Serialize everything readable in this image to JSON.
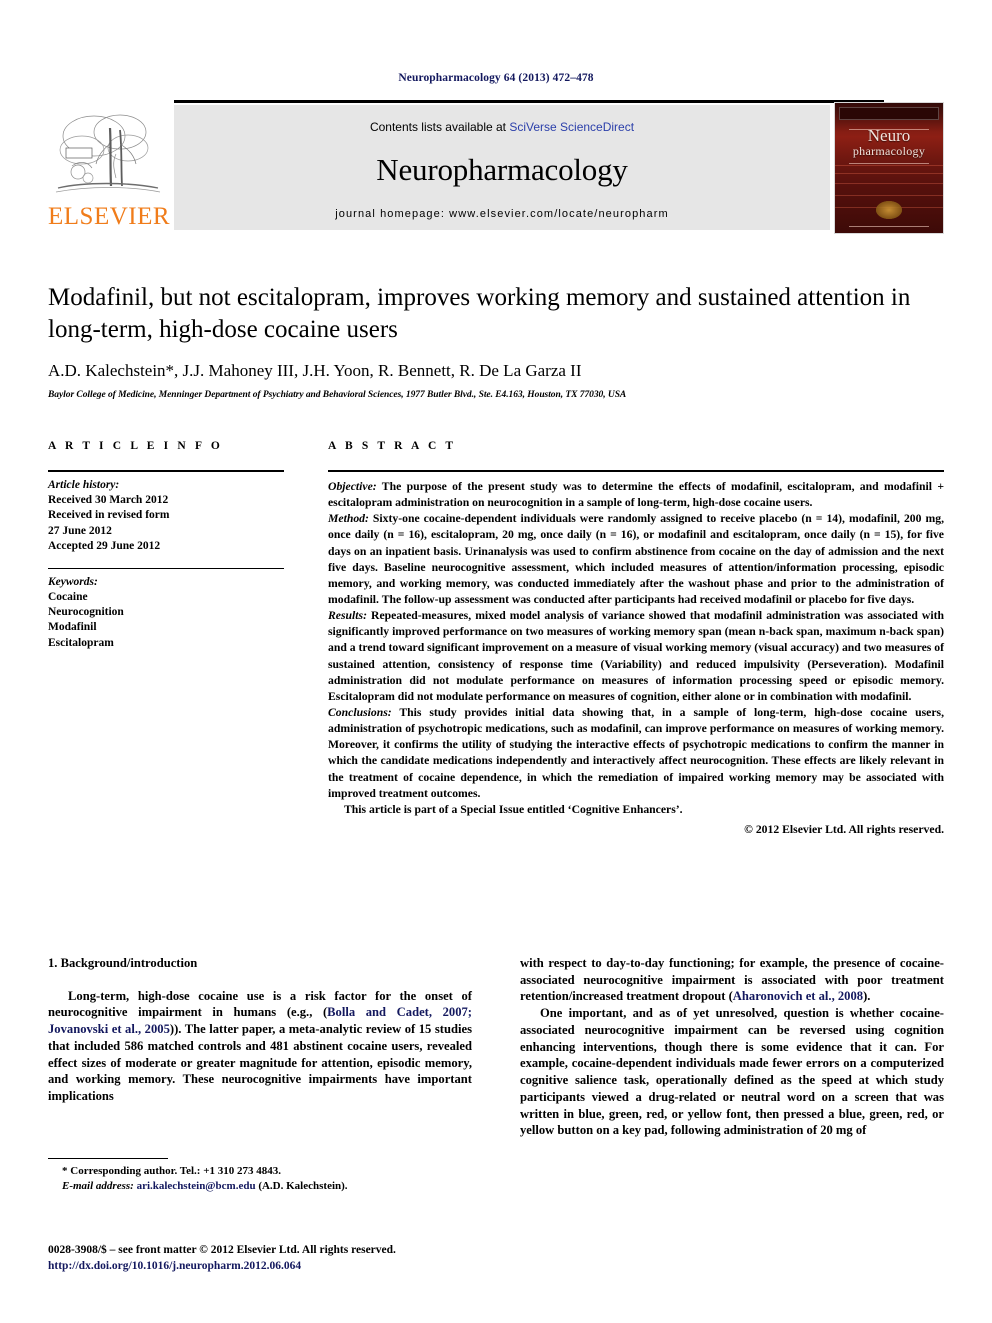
{
  "running_head": "Neuropharmacology 64 (2013) 472–478",
  "masthead": {
    "contents_prefix": "Contents lists available at ",
    "sciencedirect": "SciVerse ScienceDirect",
    "journal_name": "Neuropharmacology",
    "homepage": "journal homepage: www.elsevier.com/locate/neuropharm",
    "publisher_wordmark": "ELSEVIER",
    "cover_title_line1": "Neuro",
    "cover_title_line2": "pharmacology",
    "accent_orange": "#f07c1a",
    "link_blue": "#2b3faa"
  },
  "article": {
    "title": "Modafinil, but not escitalopram, improves working memory and sustained attention in long-term, high-dose cocaine users",
    "authors": "A.D. Kalechstein*, J.J. Mahoney III, J.H. Yoon, R. Bennett, R. De La Garza II",
    "affiliation": "Baylor College of Medicine, Menninger Department of Psychiatry and Behavioral Sciences, 1977 Butler Blvd., Ste. E4.163, Houston, TX 77030, USA"
  },
  "article_info": {
    "heading": "A R T I C L E  I N F O",
    "history_label": "Article history:",
    "history_lines": [
      "Received 30 March 2012",
      "Received in revised form",
      "27 June 2012",
      "Accepted 29 June 2012"
    ],
    "keywords_label": "Keywords:",
    "keywords": [
      "Cocaine",
      "Neurocognition",
      "Modafinil",
      "Escitalopram"
    ]
  },
  "abstract": {
    "heading": "A B S T R A C T",
    "objective_label": "Objective:",
    "objective_text": " The purpose of the present study was to determine the effects of modafinil, escitalopram, and modafinil + escitalopram administration on neurocognition in a sample of long-term, high-dose cocaine users.",
    "method_label": "Method:",
    "method_text": " Sixty-one cocaine-dependent individuals were randomly assigned to receive placebo (n = 14), modafinil, 200 mg, once daily (n = 16), escitalopram, 20 mg, once daily (n = 16), or modafinil and escitalopram, once daily (n = 15), for five days on an inpatient basis. Urinanalysis was used to confirm abstinence from cocaine on the day of admission and the next five days. Baseline neurocognitive assessment, which included measures of attention/information processing, episodic memory, and working memory, was conducted immediately after the washout phase and prior to the administration of modafinil. The follow-up assessment was conducted after participants had received modafinil or placebo for five days.",
    "results_label": "Results:",
    "results_text": " Repeated-measures, mixed model analysis of variance showed that modafinil administration was associated with significantly improved performance on two measures of working memory span (mean n-back span, maximum n-back span) and a trend toward significant improvement on a measure of visual working memory (visual accuracy) and two measures of sustained attention, consistency of response time (Variability) and reduced impulsivity (Perseveration). Modafinil administration did not modulate performance on measures of information processing speed or episodic memory. Escitalopram did not modulate performance on measures of cognition, either alone or in combination with modafinil.",
    "conclusions_label": "Conclusions:",
    "conclusions_text": " This study provides initial data showing that, in a sample of long-term, high-dose cocaine users, administration of psychotropic medications, such as modafinil, can improve performance on measures of working memory. Moreover, it confirms the utility of studying the interactive effects of psychotropic medications to confirm the manner in which the candidate medications independently and interactively affect neurocognition. These effects are likely relevant in the treatment of cocaine dependence, in which the remediation of impaired working memory may be associated with improved treatment outcomes.",
    "special_issue": "This article is part of a Special Issue entitled ‘Cognitive Enhancers’.",
    "copyright": "© 2012 Elsevier Ltd. All rights reserved."
  },
  "body": {
    "section_heading": "1. Background/introduction",
    "left_paragraph_part1": "Long-term, high-dose cocaine use is a risk factor for the onset of neurocognitive impairment in humans (e.g., (",
    "left_citation1": "Bolla and Cadet, 2007; Jovanovski et al., 2005",
    "left_paragraph_part2": ")). The latter paper, a meta-analytic review of 15 studies that included 586 matched controls and 481 abstinent cocaine users, revealed effect sizes of moderate or greater magnitude for attention, episodic memory, and working memory. These neurocognitive impairments have important implications",
    "right_paragraph1_part1": "with respect to day-to-day functioning; for example, the presence of cocaine-associated neurocognitive impairment is associated with poor treatment retention/increased treatment dropout (",
    "right_citation1": "Aharonovich et al., 2008",
    "right_paragraph1_part2": ").",
    "right_paragraph2": "One important, and as of yet unresolved, question is whether cocaine-associated neurocognitive impairment can be reversed using cognition enhancing interventions, though there is some evidence that it can. For example, cocaine-dependent individuals made fewer errors on a computerized cognitive salience task, operationally defined as the speed at which study participants viewed a drug-related or neutral word on a screen that was written in blue, green, red, or yellow font, then pressed a blue, green, red, or yellow button on a key pad, following administration of 20 mg of"
  },
  "footnotes": {
    "corresponding": "* Corresponding author. Tel.: +1 310 273 4843.",
    "email_label": "E-mail address:",
    "email_address": "ari.kalechstein@bcm.edu",
    "email_suffix": " (A.D. Kalechstein).",
    "issn_line": "0028-3908/$ – see front matter © 2012 Elsevier Ltd. All rights reserved.",
    "doi": "http://dx.doi.org/10.1016/j.neuropharm.2012.06.064"
  }
}
